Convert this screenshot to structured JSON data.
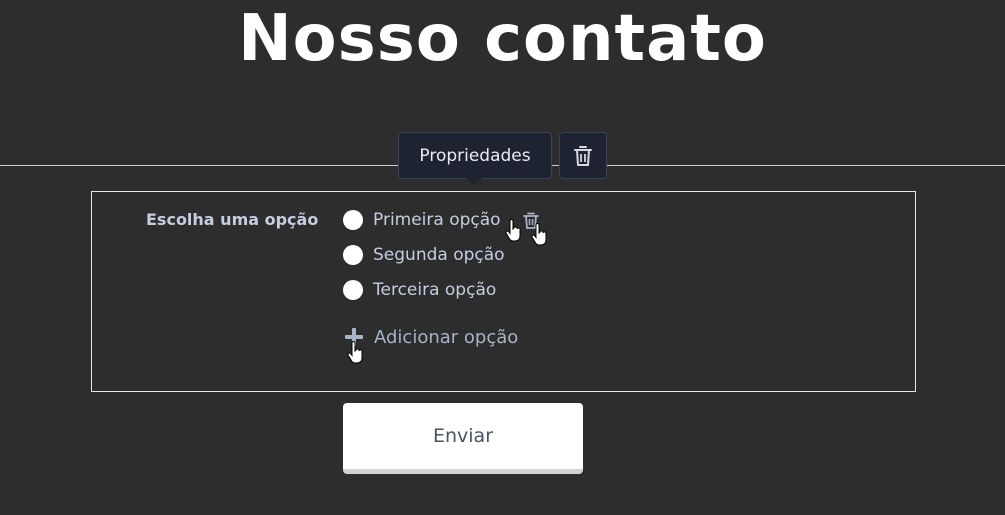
{
  "page": {
    "title": "Nosso contato"
  },
  "toolbar": {
    "properties_label": "Propriedades",
    "delete_icon": "trash-icon"
  },
  "form": {
    "field_label": "Escolha uma opção",
    "options": [
      {
        "label": "Primeira opção"
      },
      {
        "label": "Segunda opção"
      },
      {
        "label": "Terceira opção"
      }
    ],
    "add_option_label": "Adicionar opção",
    "submit_label": "Enviar"
  },
  "colors": {
    "background": "#2d2d2d",
    "toolbar_bg": "#1d2330",
    "label_text": "#c6cde0",
    "add_text": "#a9b2c6",
    "button_bg": "#ffffff"
  }
}
